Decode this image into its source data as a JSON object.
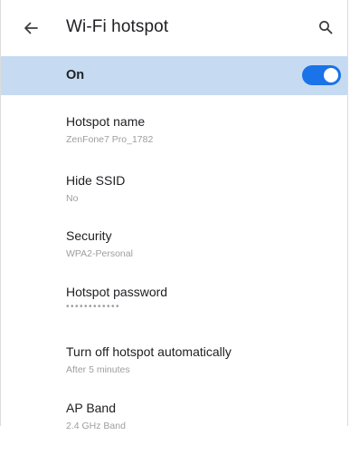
{
  "header": {
    "title": "Wi-Fi hotspot",
    "back_icon": "arrow-left-icon",
    "search_icon": "search-icon"
  },
  "master": {
    "label": "On",
    "state": true,
    "accent_color": "#1a73e8",
    "band_color": "#c6dbf2"
  },
  "settings": [
    {
      "title": "Hotspot name",
      "subtitle": "ZenFone7 Pro_1782"
    },
    {
      "title": "Hide SSID",
      "subtitle": "No"
    },
    {
      "title": "Security",
      "subtitle": "WPA2-Personal"
    },
    {
      "title": "Hotspot password",
      "subtitle": "••••••••••••"
    },
    {
      "title": "Turn off hotspot automatically",
      "subtitle": "After 5 minutes"
    },
    {
      "title": "AP Band",
      "subtitle": "2.4 GHz Band"
    }
  ]
}
